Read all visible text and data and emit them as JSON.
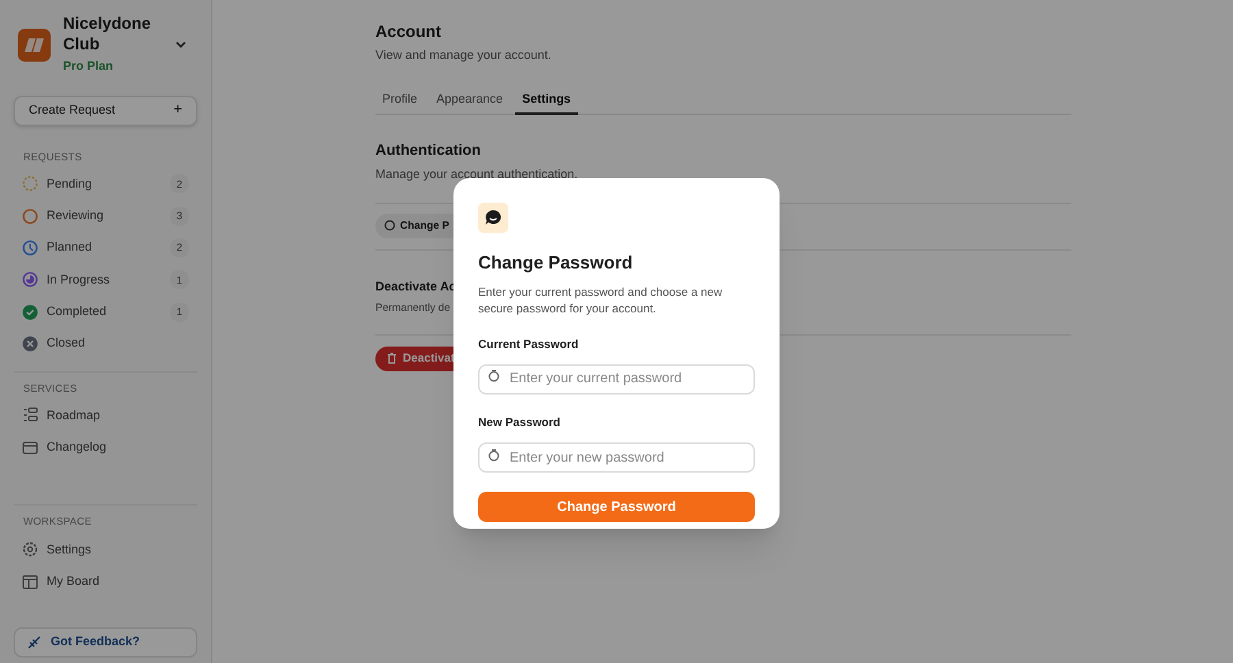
{
  "workspace": {
    "name": "Nicelydone Club",
    "plan": "Pro Plan"
  },
  "create_button": {
    "label": "Create Request",
    "icon": "+"
  },
  "sidebar": {
    "sections": [
      {
        "title": "REQUESTS",
        "items": [
          {
            "label": "Pending",
            "count": "2",
            "kind": "pending"
          },
          {
            "label": "Reviewing",
            "count": "3",
            "kind": "reviewing"
          },
          {
            "label": "Planned",
            "count": "2",
            "kind": "planned"
          },
          {
            "label": "In Progress",
            "count": "1",
            "kind": "progress"
          },
          {
            "label": "Completed",
            "count": "1",
            "kind": "completed"
          },
          {
            "label": "Closed",
            "kind": "closed"
          }
        ]
      },
      {
        "title": "SERVICES",
        "items": [
          {
            "label": "Roadmap",
            "kind": "roadmap"
          },
          {
            "label": "Changelog",
            "kind": "changelog"
          }
        ]
      },
      {
        "title": "WORKSPACE",
        "items": [
          {
            "label": "Settings",
            "kind": "settings"
          },
          {
            "label": "My Board",
            "kind": "board"
          }
        ]
      }
    ]
  },
  "feedback": {
    "label": "Got Feedback?"
  },
  "page": {
    "title": "Account",
    "subtitle": "View and manage your account."
  },
  "tabs": [
    {
      "label": "Profile",
      "selected": false
    },
    {
      "label": "Appearance",
      "selected": false
    },
    {
      "label": "Settings",
      "selected": true
    }
  ],
  "authentication": {
    "title": "Authentication",
    "subtitle": "Manage your account authentication.",
    "button": "Change P"
  },
  "deactivate": {
    "title": "Deactivate Ac",
    "subtitle": "Permanently de",
    "button": "Deactivat"
  },
  "dialog": {
    "title": "Change Password",
    "description": "Enter your current password and choose a new secure password for your account.",
    "fields": [
      {
        "label": "Current Password",
        "placeholder": "Enter your current password"
      },
      {
        "label": "New Password",
        "placeholder": "Enter your new password"
      }
    ],
    "submit": "Change Password"
  }
}
